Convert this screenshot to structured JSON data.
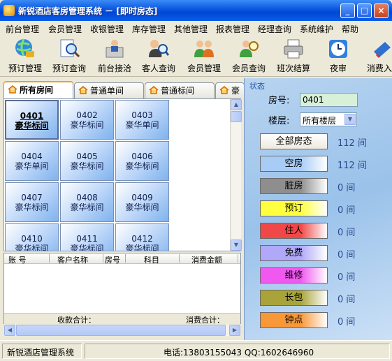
{
  "window": {
    "title": "新锐酒店客房管理系统 － [即时房态]",
    "min": "_",
    "max": "□",
    "close": "×"
  },
  "menu": [
    "前台管理",
    "会员管理",
    "收银管理",
    "库存管理",
    "其他管理",
    "报表管理",
    "经理查询",
    "系统维护",
    "帮助"
  ],
  "toolbar": [
    {
      "label": "预订管理",
      "icon": "globe-phone-icon"
    },
    {
      "label": "预订查询",
      "icon": "magnifier-doc-icon"
    },
    {
      "label": "前台接洽",
      "icon": "reception-icon"
    },
    {
      "label": "客人查询",
      "icon": "person-search-icon"
    },
    {
      "label": "会员管理",
      "icon": "members-icon"
    },
    {
      "label": "会员查询",
      "icon": "member-search-icon"
    },
    {
      "label": "班次结算",
      "icon": "printer-icon"
    },
    {
      "label": "夜审",
      "icon": "clock-icon"
    },
    {
      "label": "消费入",
      "icon": "consume-icon"
    }
  ],
  "tabs": [
    "所有房间",
    "普通单间",
    "普通标间",
    "豪"
  ],
  "rooms": [
    {
      "no": "0401",
      "type": "豪华标间",
      "selected": true
    },
    {
      "no": "0402",
      "type": "豪华标间"
    },
    {
      "no": "0403",
      "type": "豪华单间"
    },
    {
      "no": "0404",
      "type": "豪华单间"
    },
    {
      "no": "0405",
      "type": "豪华标间"
    },
    {
      "no": "0406",
      "type": "豪华标间"
    },
    {
      "no": "0407",
      "type": "豪华标间"
    },
    {
      "no": "0408",
      "type": "豪华标间"
    },
    {
      "no": "0409",
      "type": "豪华标间"
    },
    {
      "no": "0410",
      "type": "豪华标间"
    },
    {
      "no": "0411",
      "type": "豪华标间"
    },
    {
      "no": "0412",
      "type": "豪华标间"
    }
  ],
  "consume_table": {
    "columns": [
      "账  号",
      "客户名称",
      "房号",
      "科目",
      "消费金额"
    ],
    "sum_received": "收款合计：",
    "sum_consume": "消费合计："
  },
  "right": {
    "status_label": "状态",
    "room_no_label": "房号:",
    "room_no_value": "0401",
    "floor_label": "楼层:",
    "floor_value": "所有楼层",
    "buttons": [
      {
        "label": "全部房态",
        "count": "112 间",
        "color": "#eceae0"
      },
      {
        "label": "空房",
        "count": "112 间",
        "color": "#a8ccf6"
      },
      {
        "label": "脏房",
        "count": "0 间",
        "color": "#8e8e8e"
      },
      {
        "label": "预订",
        "count": "0 间",
        "color": "#ffff40"
      },
      {
        "label": "住人",
        "count": "0 间",
        "color": "#f04848"
      },
      {
        "label": "免费",
        "count": "0 间",
        "color": "#b0a8f8"
      },
      {
        "label": "维修",
        "count": "0 间",
        "color": "#f058f0"
      },
      {
        "label": "长包",
        "count": "0 间",
        "color": "#a8a43a"
      },
      {
        "label": "钟点",
        "count": "0 间",
        "color": "#f89838"
      }
    ]
  },
  "statusbar": {
    "left": "新锐酒店管理系统",
    "right": "电话:13803155043 QQ:1602646960"
  }
}
